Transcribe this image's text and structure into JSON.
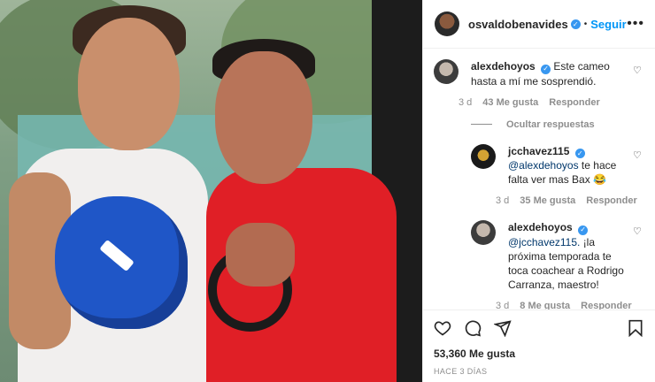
{
  "header": {
    "username": "osvaldobenavides",
    "follow_label": "Seguir",
    "dot": "•",
    "more": "•••"
  },
  "comments": [
    {
      "username": "alexdehoyos",
      "text": "Este cameo hasta a mí me sosprendió.",
      "time": "3 d",
      "likes": "43 Me gusta",
      "reply": "Responder"
    }
  ],
  "hide_replies": "Ocultar respuestas",
  "replies": [
    {
      "username": "jcchavez115",
      "mention": "@alexdehoyos",
      "text": "te hace falta ver mas Bax 😂",
      "time": "3 d",
      "likes": "35 Me gusta",
      "reply": "Responder"
    },
    {
      "username": "alexdehoyos",
      "mention": "@jcchavez115.",
      "text": "¡la próxima temporada te toca coachear a Rodrigo Carranza, maestro!",
      "time": "3 d",
      "likes": "8 Me gusta",
      "reply": "Responder"
    }
  ],
  "footer": {
    "likes": "53,360 Me gusta",
    "ago": "HACE 3 DÍAS"
  },
  "icons": {
    "like": "heart-icon",
    "comment": "comment-icon",
    "share": "share-icon",
    "save": "bookmark-icon"
  }
}
